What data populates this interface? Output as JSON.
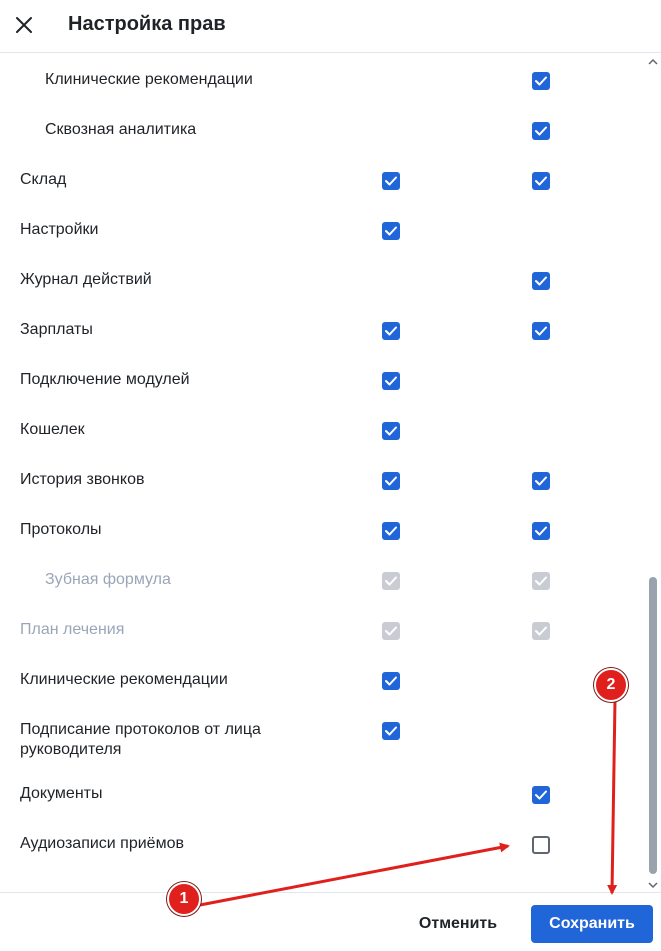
{
  "header": {
    "title": "Настройка прав",
    "close_icon": "close-icon"
  },
  "rows": [
    {
      "label": "Клинические рекомендации",
      "indent": true,
      "disabled": false,
      "col1": null,
      "col2": "checked"
    },
    {
      "label": "Сквозная аналитика",
      "indent": true,
      "disabled": false,
      "col1": null,
      "col2": "checked"
    },
    {
      "label": "Склад",
      "indent": false,
      "disabled": false,
      "col1": "checked",
      "col2": "checked"
    },
    {
      "label": "Настройки",
      "indent": false,
      "disabled": false,
      "col1": "checked",
      "col2": null
    },
    {
      "label": "Журнал действий",
      "indent": false,
      "disabled": false,
      "col1": null,
      "col2": "checked"
    },
    {
      "label": "Зарплаты",
      "indent": false,
      "disabled": false,
      "col1": "checked",
      "col2": "checked"
    },
    {
      "label": "Подключение модулей",
      "indent": false,
      "disabled": false,
      "col1": "checked",
      "col2": null
    },
    {
      "label": "Кошелек",
      "indent": false,
      "disabled": false,
      "col1": "checked",
      "col2": null
    },
    {
      "label": "История звонков",
      "indent": false,
      "disabled": false,
      "col1": "checked",
      "col2": "checked"
    },
    {
      "label": "Протоколы",
      "indent": false,
      "disabled": false,
      "col1": "checked",
      "col2": "checked"
    },
    {
      "label": "Зубная формула",
      "indent": true,
      "disabled": true,
      "col1": "checked-disabled",
      "col2": "checked-disabled"
    },
    {
      "label": "План лечения",
      "indent": false,
      "disabled": true,
      "col1": "checked-disabled",
      "col2": "checked-disabled"
    },
    {
      "label": "Клинические рекомендации",
      "indent": false,
      "disabled": false,
      "col1": "checked",
      "col2": null
    },
    {
      "label": "Подписание протоколов от лица руководителя",
      "indent": false,
      "disabled": false,
      "col1": "checked",
      "col2": null
    },
    {
      "label": "Документы",
      "indent": false,
      "disabled": false,
      "col1": null,
      "col2": "checked"
    },
    {
      "label": "Аудиозаписи приёмов",
      "indent": false,
      "disabled": false,
      "col1": null,
      "col2": "unchecked"
    }
  ],
  "footer": {
    "cancel_label": "Отменить",
    "save_label": "Сохранить"
  },
  "annotations": {
    "badge1": "1",
    "badge2": "2",
    "color": "#e0201c"
  },
  "colors": {
    "accent": "#2166d8",
    "disabled_text": "#9aa6b8",
    "disabled_check": "#c9cdd3"
  }
}
